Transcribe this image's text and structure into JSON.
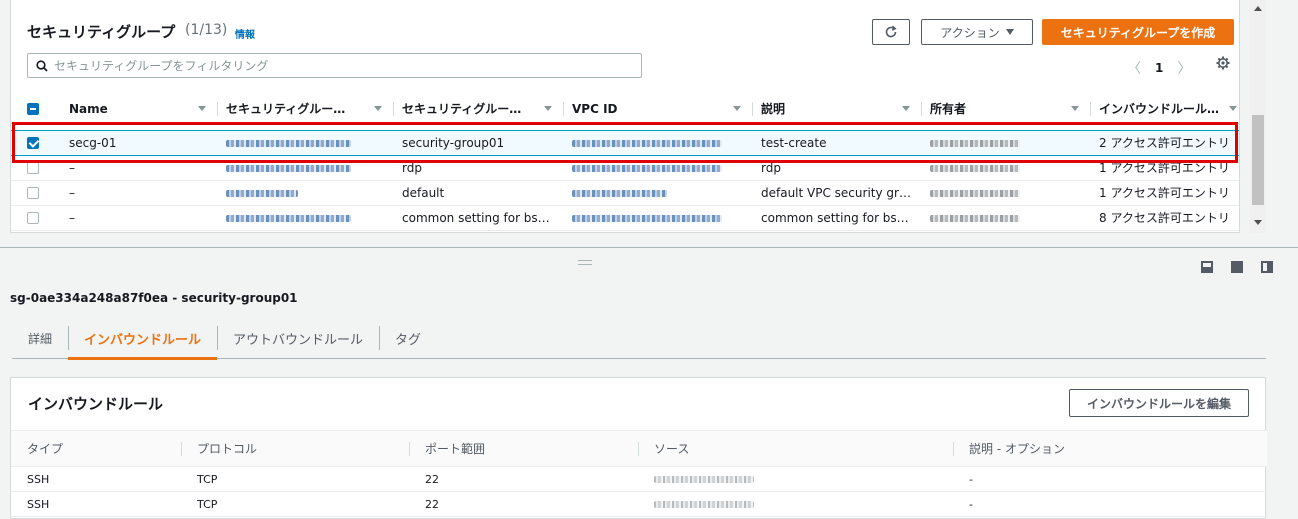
{
  "panel": {
    "title": "セキュリティグループ",
    "count": "(1/13)",
    "info": "情報",
    "refresh_icon": "refresh-icon",
    "action_label": "アクション",
    "create_label": "セキュリティグループを作成",
    "search_placeholder": "セキュリティグループをフィルタリング",
    "page": "1"
  },
  "table": {
    "headers": [
      "Name",
      "セキュリティグルー…",
      "セキュリティグルー…",
      "VPC ID",
      "説明",
      "所有者",
      "インバウンドルール…"
    ],
    "rows": [
      {
        "name": "secg-01",
        "group_name": "security-group01",
        "description": "test-create",
        "inbound": "2 アクセス許可エントリ",
        "selected": true
      },
      {
        "name": "–",
        "group_name": "rdp",
        "description": "rdp",
        "inbound": "1 アクセス許可エントリ",
        "selected": false
      },
      {
        "name": "–",
        "group_name": "default",
        "description": "default VPC security gr…",
        "inbound": "1 アクセス許可エントリ",
        "selected": false
      },
      {
        "name": "–",
        "group_name": "common setting for bs…",
        "description": "common setting for bs…",
        "inbound": "8 アクセス許可エントリ",
        "selected": false
      }
    ]
  },
  "details": {
    "title": "sg-0ae334a248a87f0ea - security-group01",
    "tabs": [
      "詳細",
      "インバウンドルール",
      "アウトバウンドルール",
      "タグ"
    ],
    "active_tab": "インバウンドルール"
  },
  "rules": {
    "title": "インバウンドルール",
    "edit_label": "インバウンドルールを編集",
    "headers": [
      "タイプ",
      "プロトコル",
      "ポート範囲",
      "ソース",
      "説明 - オプション"
    ],
    "rows": [
      {
        "type": "SSH",
        "protocol": "TCP",
        "port": "22",
        "desc": "-"
      },
      {
        "type": "SSH",
        "protocol": "TCP",
        "port": "22",
        "desc": "-"
      }
    ]
  },
  "colors": {
    "accent": "#ec7211",
    "link": "#0073bb",
    "highlight": "#e00000"
  }
}
